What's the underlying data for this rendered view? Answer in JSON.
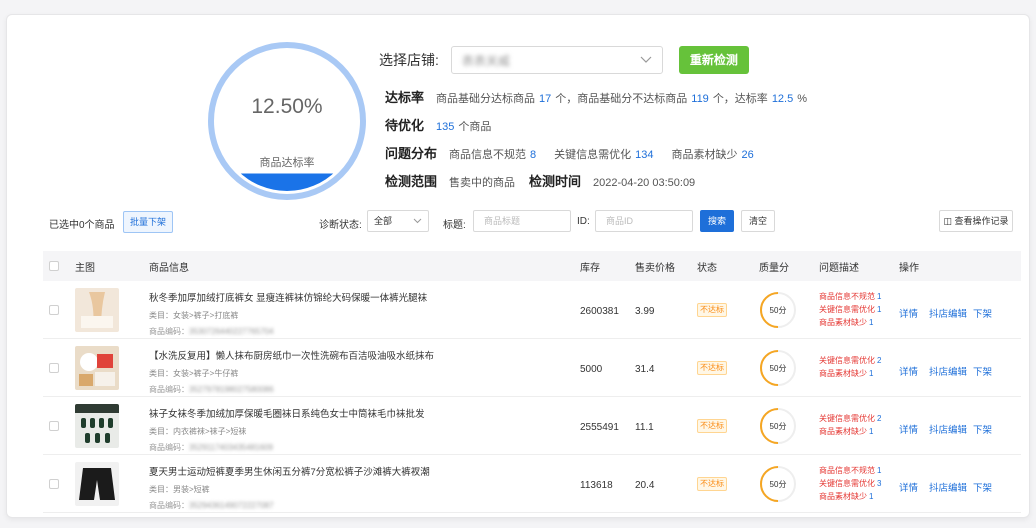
{
  "gauge": {
    "value_text": "12.50%",
    "label": "商品达标率",
    "fill_fraction": 0.125,
    "ring_color": "#a9c9f5",
    "fill_color": "#1a73e8"
  },
  "store": {
    "label": "选择店铺:",
    "selected": "表表关威",
    "recheck_button": "重新检测"
  },
  "rate": {
    "head": "达标率",
    "t1": "商品基础分达标商品",
    "n1": "17",
    "t2": "个，商品基础分不达标商品",
    "n2": "119",
    "t3": "个，达标率",
    "n3": "12.5",
    "t4": "%"
  },
  "pending": {
    "head": "待优化",
    "n": "135",
    "t": "个商品"
  },
  "issues": {
    "head": "问题分布",
    "a_label": "商品信息不规范",
    "a_n": "8",
    "b_label": "关键信息需优化",
    "b_n": "134",
    "c_label": "商品素材缺少",
    "c_n": "26"
  },
  "scope": {
    "head": "检测范围",
    "value": "售卖中的商品",
    "time_head": "检测时间",
    "time_value": "2022-04-20 03:50:09"
  },
  "filters": {
    "selected_text": "已选中0个商品",
    "batch_button": "批量下架",
    "status_label": "诊断状态:",
    "status_value": "全部",
    "title_label": "标题:",
    "title_placeholder": "商品标题",
    "id_label": "ID:",
    "id_placeholder": "商品ID",
    "search_button": "搜索",
    "clear_button": "清空",
    "log_button": "查看操作记录"
  },
  "columns": [
    "主图",
    "商品信息",
    "库存",
    "售卖价格",
    "状态",
    "质量分",
    "问题描述",
    "操作"
  ],
  "rows": [
    {
      "title": "秋冬季加厚加绒打底裤女 显瘦连裤袜仿锦纶大码保暖一体裤光腿袜",
      "category": "类目：女装>裤子>打底裤",
      "code_label": "商品编码：",
      "code": "3530726440227765704",
      "stock": "2600381",
      "price": "3.99",
      "status": "不达标",
      "score": "50分",
      "issues": [
        {
          "label": "商品信息不规范",
          "n": "1"
        },
        {
          "label": "关键信息需优化",
          "n": "1"
        },
        {
          "label": "商品素材缺少",
          "n": "1"
        }
      ]
    },
    {
      "title": "【水洗反复用】懒人抹布厨房纸巾一次性洗碗布百洁吸油吸水纸抹布",
      "category": "类目：女装>裤子>牛仔裤",
      "code_label": "商品编码：",
      "code": "3527978198027580086",
      "stock": "5000",
      "price": "31.4",
      "status": "不达标",
      "score": "50分",
      "issues": [
        {
          "label": "关键信息需优化",
          "n": "2"
        },
        {
          "label": "商品素材缺少",
          "n": "1"
        }
      ]
    },
    {
      "title": "袜子女袜冬季加绒加厚保暖毛圈袜日系纯色女士中筒袜毛巾袜批发",
      "category": "类目：内衣裤袜>袜子>短袜",
      "code_label": "商品编码：",
      "code": "3529117403435481609",
      "stock": "2555491",
      "price": "11.1",
      "status": "不达标",
      "score": "50分",
      "issues": [
        {
          "label": "关键信息需优化",
          "n": "2"
        },
        {
          "label": "商品素材缺少",
          "n": "1"
        }
      ]
    },
    {
      "title": "夏天男士运动短裤夏季男生休闲五分裤7分宽松裤子沙滩裤大裤衩潮",
      "category": "类目：男装>短裤",
      "code_label": "商品编码：",
      "code": "3529436149072227087",
      "stock": "113618",
      "price": "20.4",
      "status": "不达标",
      "score": "50分",
      "issues": [
        {
          "label": "商品信息不规范",
          "n": "1"
        },
        {
          "label": "关键信息需优化",
          "n": "3"
        },
        {
          "label": "商品素材缺少",
          "n": "1"
        }
      ]
    }
  ],
  "ops": {
    "detail": "详情",
    "edit": "抖店编辑",
    "off": "下架"
  },
  "colors": {
    "blue": "#1e6fd9",
    "green": "#66c23a",
    "red": "#e53935",
    "orange": "#fa8c16"
  }
}
